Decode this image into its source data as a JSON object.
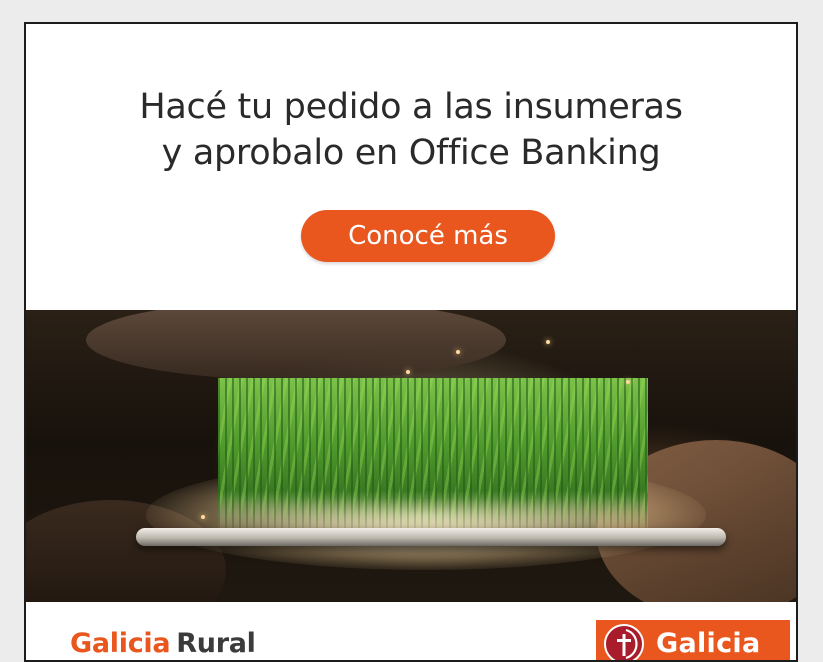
{
  "ad": {
    "headline_line1": "Hacé tu pedido a las insumeras",
    "headline_line2": "y aprobalo en Office Banking",
    "cta_label": "Conocé más",
    "image_alt": "crop-field-on-tablet",
    "footer": {
      "brand_word1": "Galicia",
      "brand_word2": "Rural",
      "logo_text": "Galicia",
      "logo_icon": "galicia-cross-icon"
    }
  },
  "colors": {
    "accent": "#e9571e",
    "text_dark": "#2a2a2a",
    "logo_mark": "#a81c2c",
    "border": "#1c1c1c",
    "page_bg": "#ececec"
  }
}
